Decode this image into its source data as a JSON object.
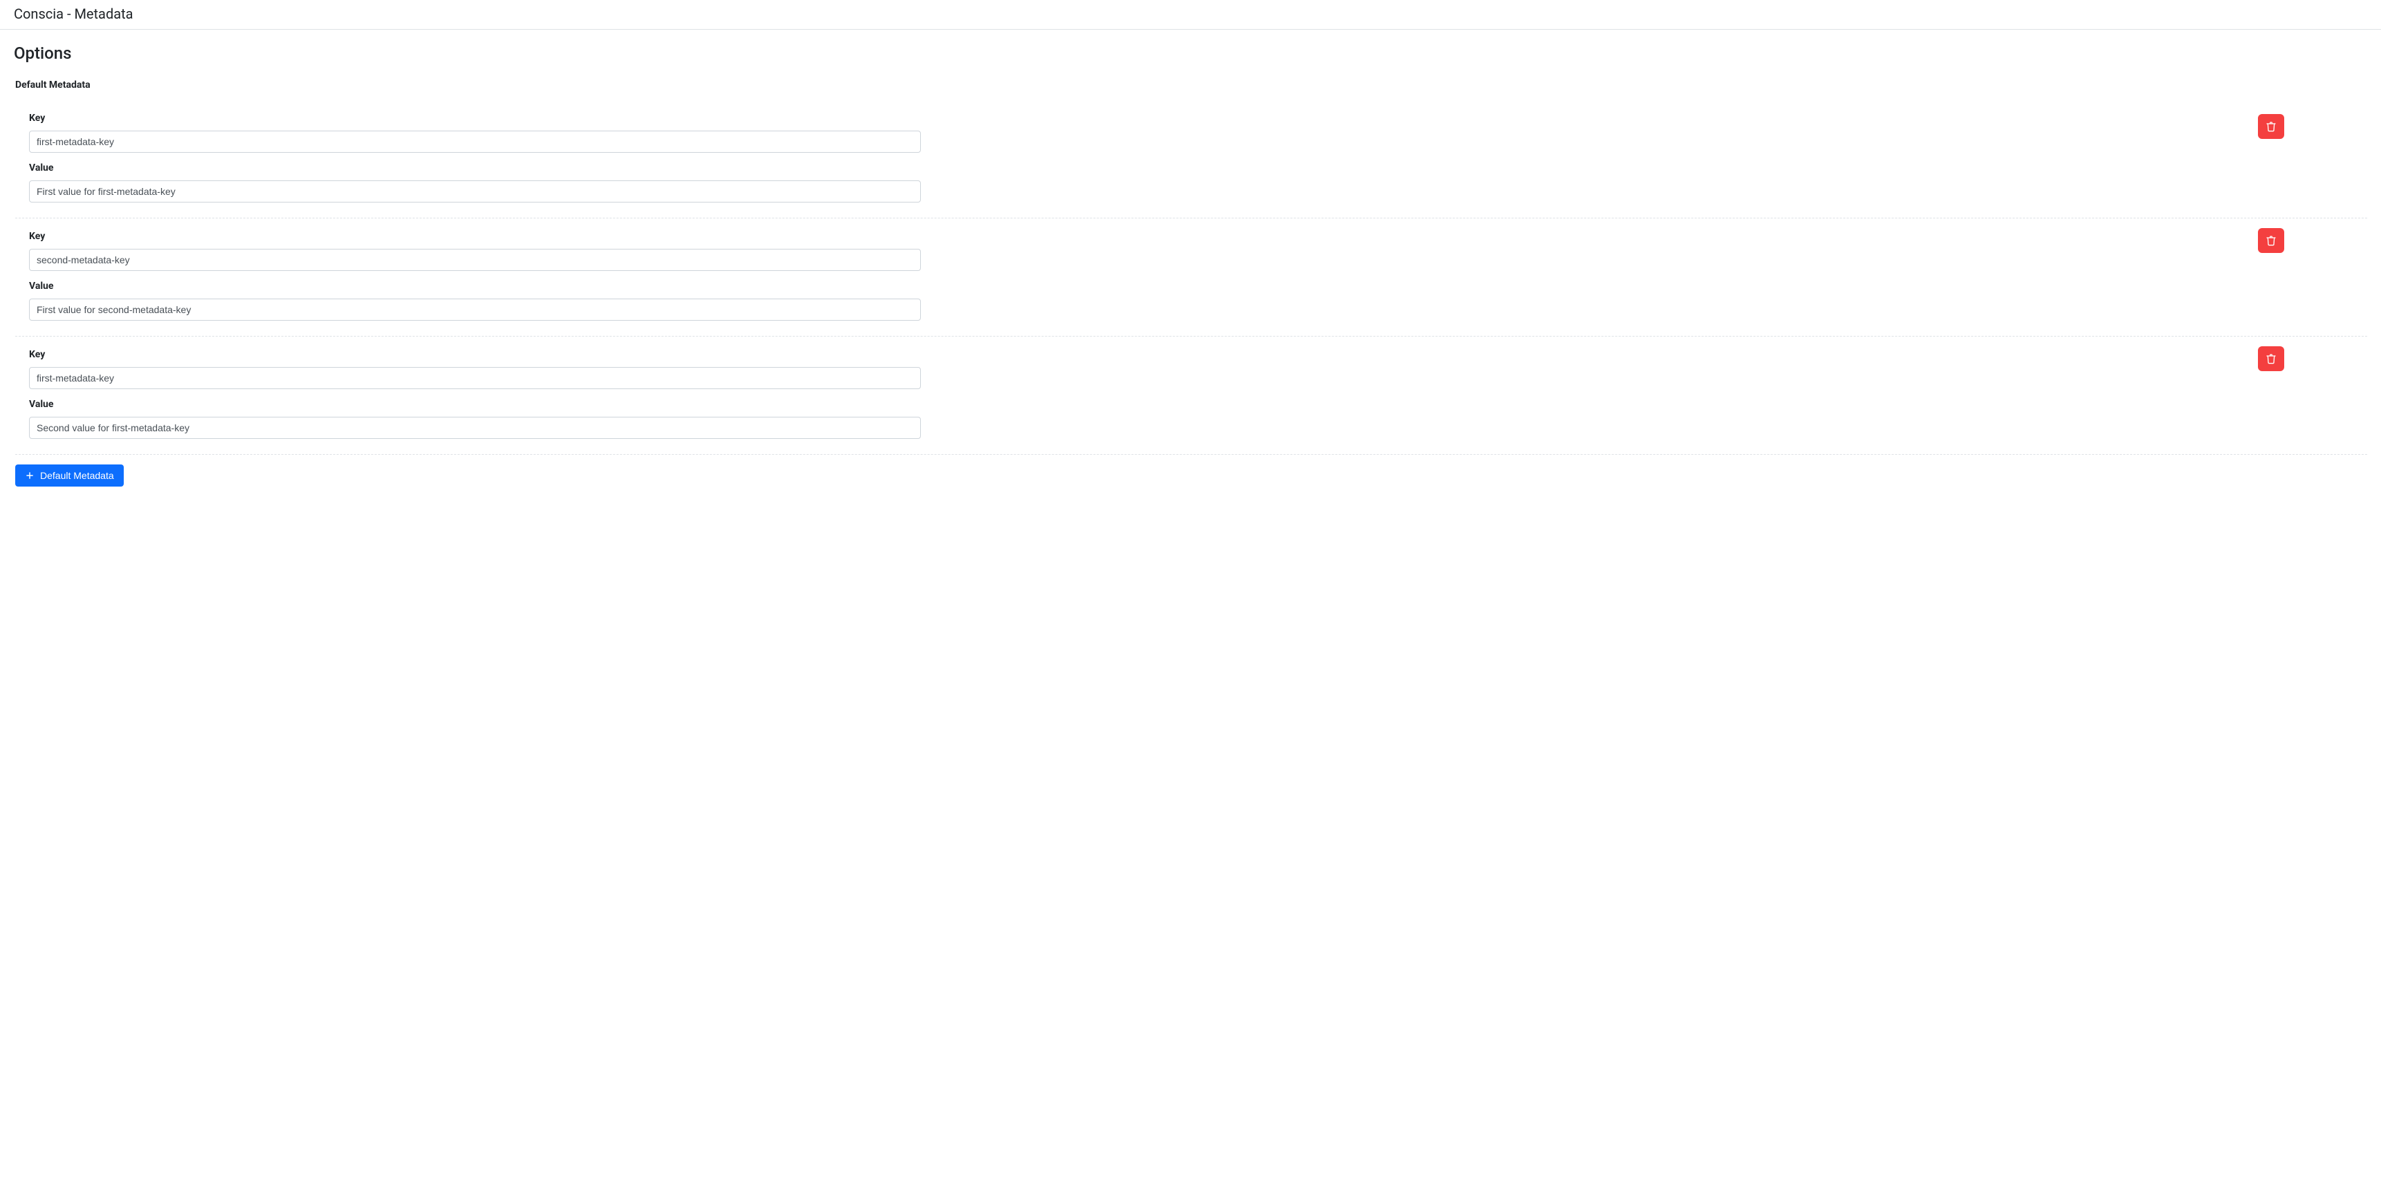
{
  "header": {
    "title": "Conscia - Metadata"
  },
  "page": {
    "title": "Options",
    "group_label": "Default Metadata",
    "key_label": "Key",
    "value_label": "Value",
    "add_button_label": "Default Metadata"
  },
  "entries": [
    {
      "key": "first-metadata-key",
      "value": "First value for first-metadata-key"
    },
    {
      "key": "second-metadata-key",
      "value": "First value for second-metadata-key"
    },
    {
      "key": "first-metadata-key",
      "value": "Second value for first-metadata-key"
    }
  ]
}
